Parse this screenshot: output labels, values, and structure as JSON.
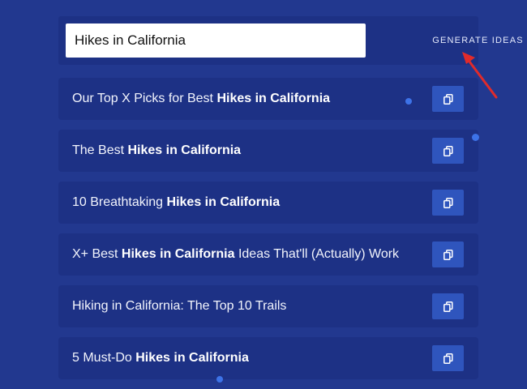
{
  "search": {
    "value": "Hikes in California",
    "button_label": "Generate Ideas"
  },
  "results": [
    {
      "before": "Our Top X Picks for Best ",
      "bold": "Hikes in California",
      "after": ""
    },
    {
      "before": "The Best ",
      "bold": "Hikes in California",
      "after": ""
    },
    {
      "before": "10 Breathtaking ",
      "bold": "Hikes in California",
      "after": ""
    },
    {
      "before": "X+ Best ",
      "bold": "Hikes in California",
      "after": " Ideas That'll (Actually) Work"
    },
    {
      "before": "Hiking in California: The Top 10 Trails",
      "bold": "",
      "after": ""
    },
    {
      "before": "5 Must-Do ",
      "bold": "Hikes in California",
      "after": ""
    }
  ],
  "icons": {
    "copy": "copy-icon",
    "annotation_arrow": "arrow-annotation-icon"
  },
  "colors": {
    "background": "#22388f",
    "panel": "#1d3185",
    "copy_button": "#2f55bd",
    "arrow": "#e02b2b"
  }
}
